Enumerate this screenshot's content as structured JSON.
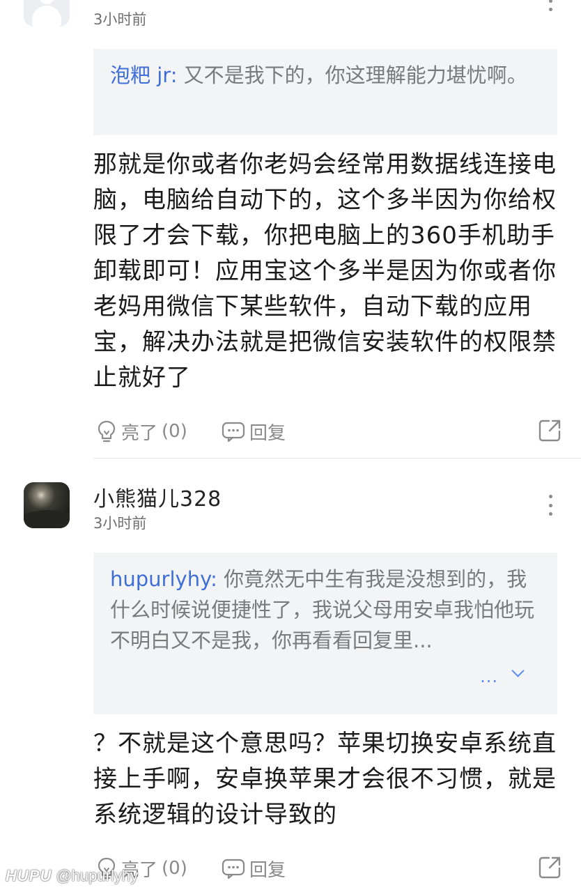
{
  "comments": [
    {
      "username": "",
      "time": "3小时前",
      "quote": {
        "author": "泡粑 jr:",
        "text": " 又不是我下的，你这理解能力堪忧啊。"
      },
      "body": "那就是你或者你老妈会经常用数据线连接电脑，电脑给自动下的，这个多半因为你给权限了才会下载，你把电脑上的360手机助手卸载即可！应用宝这个多半是因为你或者你老妈用微信下某些软件，自动下载的应用宝，解决办法就是把微信安装软件的权限禁止就好了",
      "like_label": "亮了",
      "like_count": "(0)",
      "reply_label": "回复"
    },
    {
      "username": "小熊猫儿328",
      "time": "3小时前",
      "quote": {
        "author": "hupurlyhy:",
        "text": " 你竟然无中生有我是没想到的，我什么时候说便捷性了，我说父母用安卓我怕他玩不明白又不是我，你再看看回复里...",
        "expand": "..."
      },
      "body": "？不就是这个意思吗？苹果切换安卓系统直接上手啊，安卓换苹果才会很不习惯，就是系统逻辑的设计导致的",
      "like_label": "亮了",
      "like_count": "(0)",
      "reply_label": "回复"
    }
  ],
  "watermark": {
    "brand": "HUPU",
    "handle": "@hupurlyhy"
  },
  "colors": {
    "quote_author": "#3f6fd6",
    "quote_bg": "#f3f4f6",
    "icon_gray": "#8a8a8a"
  }
}
